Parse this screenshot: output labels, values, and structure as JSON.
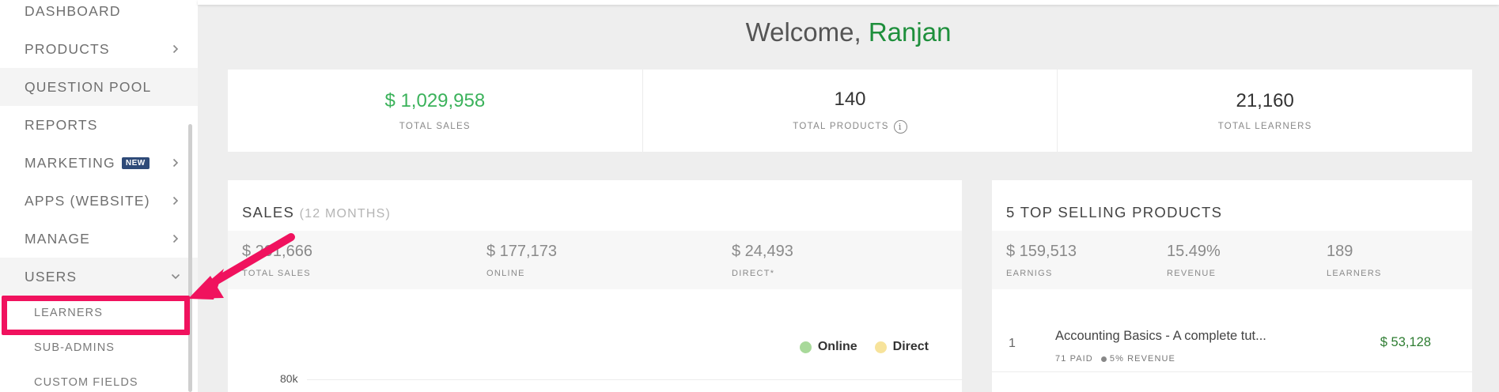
{
  "sidebar": {
    "items": [
      {
        "label": "DASHBOARD",
        "chevron": ""
      },
      {
        "label": "PRODUCTS",
        "chevron": "right"
      },
      {
        "label": "QUESTION POOL",
        "chevron": ""
      },
      {
        "label": "REPORTS",
        "chevron": ""
      },
      {
        "label": "MARKETING",
        "badge": "NEW",
        "chevron": "right"
      },
      {
        "label": "APPS (WEBSITE)",
        "chevron": "right"
      },
      {
        "label": "MANAGE",
        "chevron": "right"
      },
      {
        "label": "USERS",
        "chevron": "down"
      }
    ],
    "users_sub": [
      "LEARNERS",
      "SUB-ADMINS",
      "CUSTOM FIELDS"
    ]
  },
  "welcome": {
    "greeting": "Welcome,",
    "name": "Ranjan"
  },
  "kpis": [
    {
      "value": "$ 1,029,958",
      "label": "TOTAL SALES"
    },
    {
      "value": "140",
      "label": "TOTAL PRODUCTS"
    },
    {
      "value": "21,160",
      "label": "TOTAL LEARNERS"
    }
  ],
  "sales_card": {
    "title": "SALES",
    "subtitle": "(12 MONTHS)",
    "stats": [
      {
        "value": "$ 201,666",
        "label": "TOTAL SALES"
      },
      {
        "value": "$ 177,173",
        "label": "ONLINE"
      },
      {
        "value": "$ 24,493",
        "label": "DIRECT*"
      }
    ],
    "legend": [
      {
        "name": "Online",
        "color": "#a8d99a"
      },
      {
        "name": "Direct",
        "color": "#f7e39b"
      }
    ],
    "axis_tick": "80k"
  },
  "top_card": {
    "title": "5 TOP SELLING PRODUCTS",
    "stats": [
      {
        "value": "$ 159,513",
        "label": "EARNIGS"
      },
      {
        "value": "15.49%",
        "label": "REVENUE"
      },
      {
        "value": "189",
        "label": "LEARNERS"
      }
    ],
    "products": [
      {
        "rank": "1",
        "name": "Accounting Basics - A complete tut...",
        "paid": "71 PAID",
        "revenue": "5% REVENUE",
        "earnings": "$ 53,128"
      }
    ]
  },
  "colors": {
    "accent_green": "#3bb25b",
    "highlight": "#f0125e",
    "badge": "#2e4a78"
  }
}
